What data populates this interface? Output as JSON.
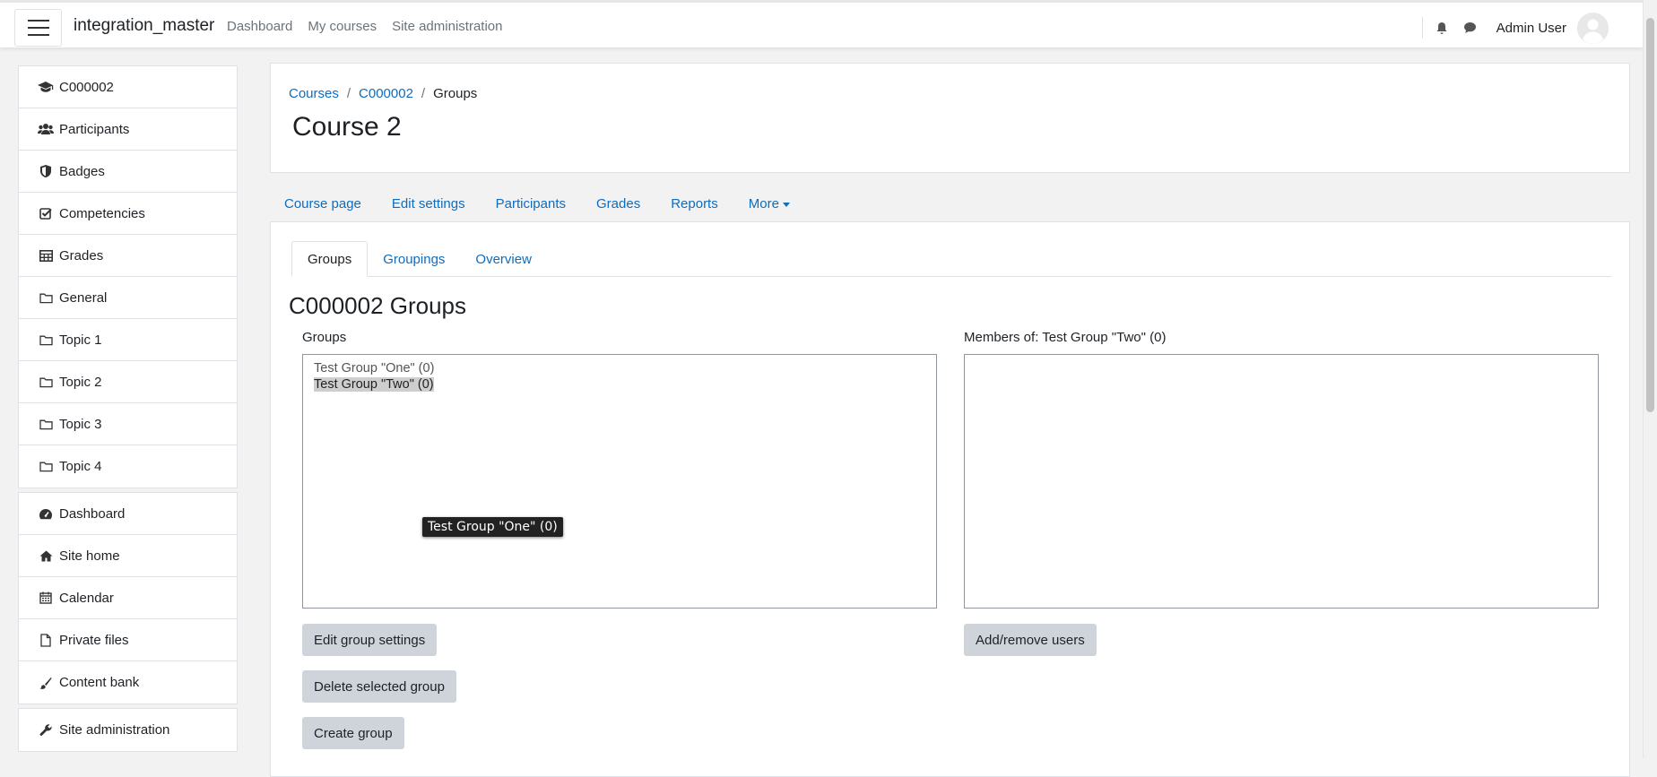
{
  "topbar": {
    "site_name": "integration_master",
    "nav": [
      "Dashboard",
      "My courses",
      "Site administration"
    ],
    "user_name": "Admin User"
  },
  "sidebar": {
    "course_items": [
      {
        "label": "C000002",
        "icon": "graduation-cap-icon"
      },
      {
        "label": "Participants",
        "icon": "users-icon"
      },
      {
        "label": "Badges",
        "icon": "shield-icon"
      },
      {
        "label": "Competencies",
        "icon": "check-square-icon"
      },
      {
        "label": "Grades",
        "icon": "table-icon"
      },
      {
        "label": "General",
        "icon": "folder-icon"
      },
      {
        "label": "Topic 1",
        "icon": "folder-icon"
      },
      {
        "label": "Topic 2",
        "icon": "folder-icon"
      },
      {
        "label": "Topic 3",
        "icon": "folder-icon"
      },
      {
        "label": "Topic 4",
        "icon": "folder-icon"
      }
    ],
    "site_items": [
      {
        "label": "Dashboard",
        "icon": "tachometer-icon"
      },
      {
        "label": "Site home",
        "icon": "home-icon"
      },
      {
        "label": "Calendar",
        "icon": "calendar-icon"
      },
      {
        "label": "Private files",
        "icon": "file-icon"
      },
      {
        "label": "Content bank",
        "icon": "paint-brush-icon"
      }
    ],
    "admin_items": [
      {
        "label": "Site administration",
        "icon": "wrench-icon"
      }
    ]
  },
  "header": {
    "breadcrumb": [
      "Courses",
      "C000002",
      "Groups"
    ],
    "course_title": "Course 2"
  },
  "secondary_nav": [
    "Course page",
    "Edit settings",
    "Participants",
    "Grades",
    "Reports",
    "More"
  ],
  "tabs": [
    "Groups",
    "Groupings",
    "Overview"
  ],
  "main": {
    "heading": "C000002 Groups",
    "groups_label": "Groups",
    "groups": [
      "Test Group \"One\" (0)",
      "Test Group \"Two\" (0)"
    ],
    "selected_group_index": 1,
    "members_label": "Members of: Test Group \"Two\" (0)",
    "tooltip": "Test Group \"One\" (0)",
    "buttons": {
      "edit_group_settings": "Edit group settings",
      "delete_selected_group": "Delete selected group",
      "create_group": "Create group",
      "add_remove_users": "Add/remove users"
    }
  },
  "colors": {
    "link": "#0f6cbf",
    "button_bg": "#ced4da",
    "page_bg": "#f2f2f2"
  }
}
